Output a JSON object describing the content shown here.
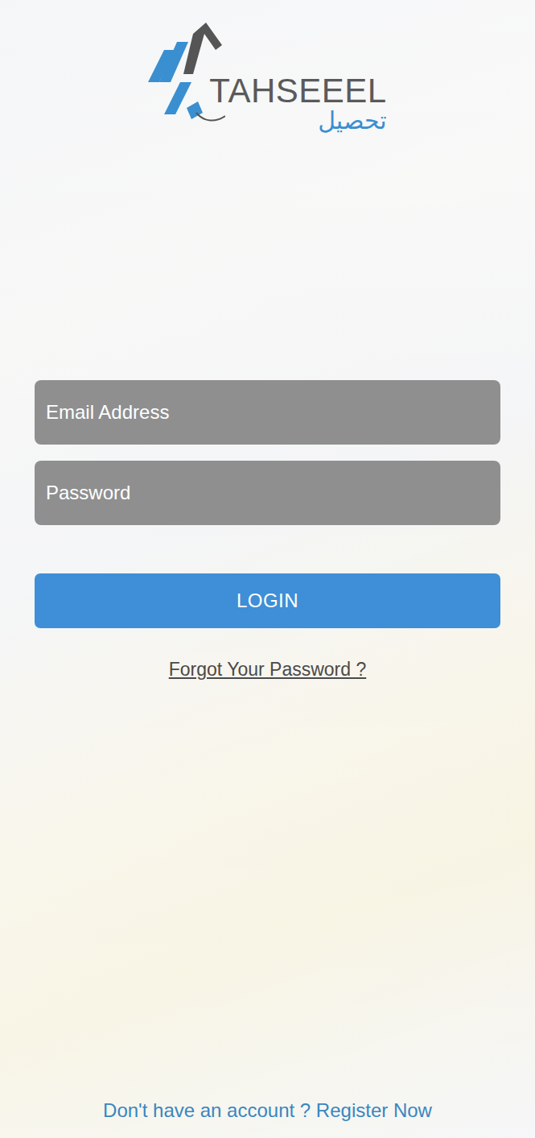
{
  "logo": {
    "text": "TAHSEEEL",
    "arabic": "تحصيل"
  },
  "form": {
    "email": {
      "placeholder": "Email Address"
    },
    "password": {
      "placeholder": "Password"
    },
    "login": "LOGIN",
    "forgot": "Forgot Your Password ?"
  },
  "footer": {
    "question": "Don't have an account ?",
    "link": "Register Now"
  }
}
